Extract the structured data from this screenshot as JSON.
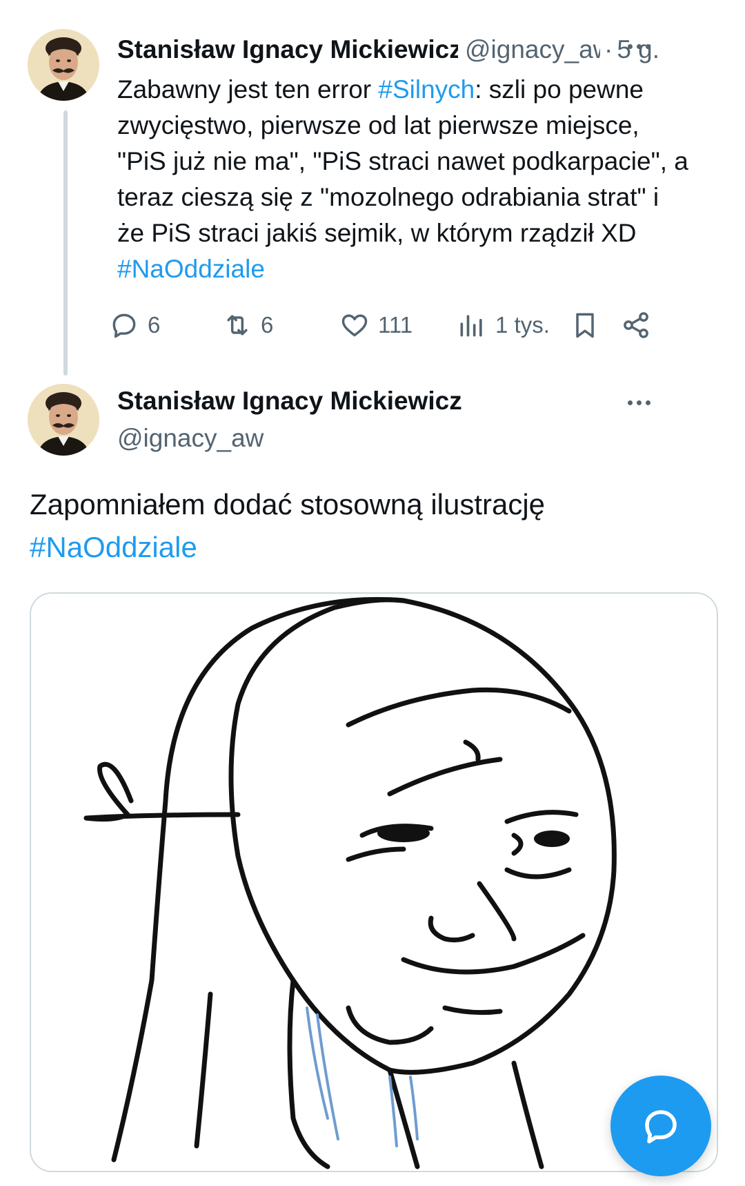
{
  "tweet1": {
    "author_name": "Stanisław Ignacy Mickiewicz",
    "handle": "@ignacy_aw",
    "separator": "·",
    "time": "5 g.",
    "body_lines": [
      [
        "Zabawny jest ten error ",
        "#Silnych",
        ": szli po pewne"
      ],
      [
        "zwycięstwo, pierwsze od lat pierwsze miejsce,"
      ],
      [
        "\"PiS już nie ma\", \"PiS straci nawet podkarpacie\", a"
      ],
      [
        "teraz cieszą się z \"mozolnego odrabiania strat\" i"
      ],
      [
        "że PiS straci jakiś sejmik, w którym rządził XD"
      ],
      [
        "#NaOddziale"
      ]
    ],
    "actions": {
      "replies": "6",
      "reposts": "6",
      "likes": "111",
      "views": "1 tys."
    }
  },
  "tweet2": {
    "author_name": "Stanisław Ignacy Mickiewicz",
    "handle": "@ignacy_aw",
    "body_line1": "Zapomniałem dodać stosowną ilustrację",
    "hashtag": "#NaOddziale",
    "media": {
      "description_icon": "meme-face-image"
    }
  },
  "colors": {
    "accent": "#1d9bf0",
    "text": "#0f1419",
    "muted": "#536471",
    "border": "#cfd9de"
  },
  "icons": {
    "reply": "reply-icon",
    "repost": "repost-icon",
    "like": "heart-icon",
    "views": "views-icon",
    "bookmark": "bookmark-icon",
    "share": "share-icon",
    "more": "more-icon",
    "compose": "compose-reply-icon"
  }
}
